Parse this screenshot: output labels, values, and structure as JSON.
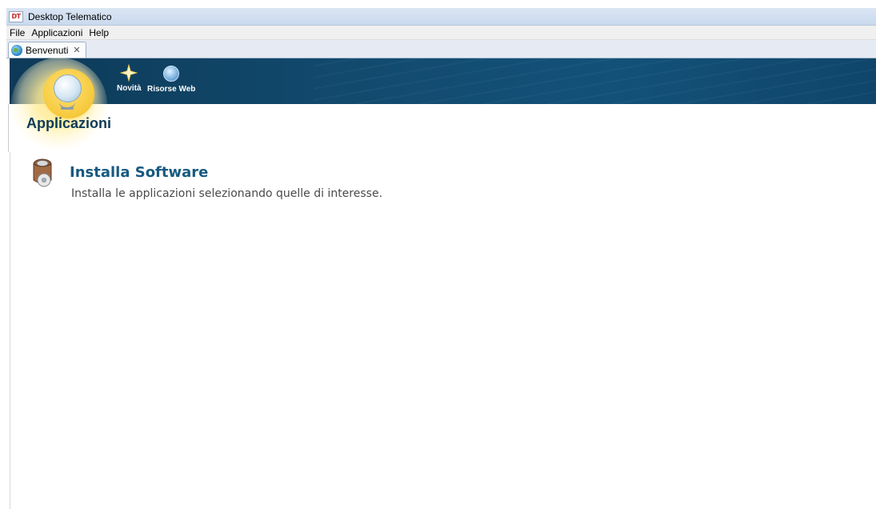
{
  "window": {
    "title": "Desktop Telematico",
    "logo_text": "DT"
  },
  "menubar": {
    "items": [
      {
        "label": "File"
      },
      {
        "label": "Applicazioni"
      },
      {
        "label": "Help"
      }
    ]
  },
  "tabs": [
    {
      "label": "Benvenuti",
      "icon": "globe-icon",
      "close_icon": "close-icon"
    }
  ],
  "banner": {
    "colors": {
      "background": "#124a6e",
      "glow": "#ffe37a"
    },
    "nav": [
      {
        "label": "Novità",
        "icon": "star-icon"
      },
      {
        "label": "Risorse Web",
        "icon": "web-icon"
      }
    ]
  },
  "content": {
    "heading": "Applicazioni",
    "items": [
      {
        "title": "Installa Software",
        "description": "Installa le applicazioni selezionando quelle di interesse.",
        "icon": "software-package-icon"
      }
    ]
  }
}
